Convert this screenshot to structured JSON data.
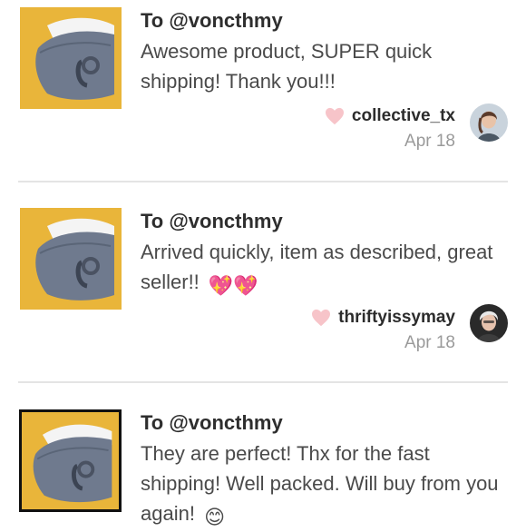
{
  "reviews": [
    {
      "to": "To @voncthmy",
      "comment": "Awesome product, SUPER quick shipping! Thank you!!!",
      "reviewer": "collective_tx",
      "date": "Apr 18",
      "thumb_icon": "gray-face-mask-product-photo",
      "avatar_icon": "user-avatar-photo"
    },
    {
      "to": "To @voncthmy",
      "comment": "Arrived quickly, item as described, great seller!!",
      "comment_emoji": "💖💖",
      "reviewer": "thriftyissymay",
      "date": "Apr 18",
      "thumb_icon": "gray-face-mask-product-photo",
      "avatar_icon": "user-avatar-photo"
    },
    {
      "to": "To @voncthmy",
      "comment": "They are perfect! Thx for the fast shipping! Well packed. Will buy from you again!",
      "comment_emoji": "😊",
      "thumb_icon": "gray-face-mask-product-photo"
    }
  ],
  "colors": {
    "heart": "#f7c4c9",
    "thumb_background": "#e9b53a",
    "divider": "#e4e4e4",
    "date_text": "#9a9a9a"
  }
}
